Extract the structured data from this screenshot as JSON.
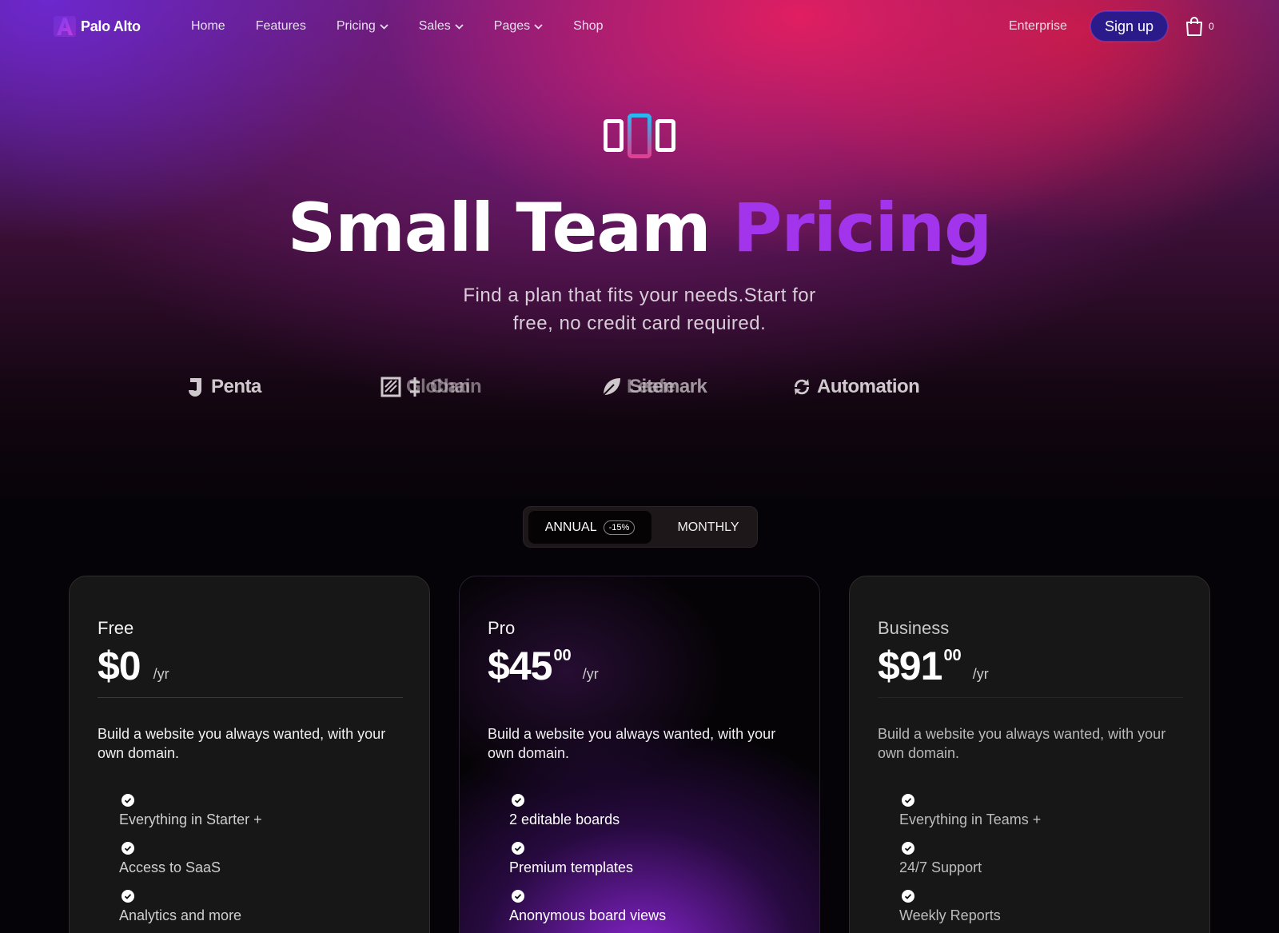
{
  "nav": {
    "brand": "Palo Alto",
    "links": [
      {
        "label": "Home",
        "dropdown": false
      },
      {
        "label": "Features",
        "dropdown": false
      },
      {
        "label": "Pricing",
        "dropdown": true
      },
      {
        "label": "Sales",
        "dropdown": true
      },
      {
        "label": "Pages",
        "dropdown": true
      },
      {
        "label": "Shop",
        "dropdown": false
      }
    ],
    "enterprise": "Enterprise",
    "signup": "Sign up",
    "cart_count": "0",
    "icons": [
      "logo-icon",
      "chevron-down-icon",
      "shopping-bag-icon"
    ]
  },
  "hero": {
    "title_main": "Small Team",
    "title_accent": "Pricing",
    "subtitle": "Find a plan that fits your needs.Start for free, no credit card required.",
    "accent_color": "#a234ec"
  },
  "brands": [
    {
      "name": "Penta",
      "icon": "penta-logo-icon"
    },
    {
      "name": "Globan",
      "icon": "globan-logo-icon"
    },
    {
      "name": "Chain",
      "icon": "chain-logo-icon"
    },
    {
      "name": "Leafe",
      "icon": "leafe-logo-icon"
    },
    {
      "name": "Sitemark",
      "icon": "sitemark-logo-icon"
    },
    {
      "name": "Automation",
      "icon": "automation-logo-icon"
    }
  ],
  "billing": {
    "annual": "ANNUAL",
    "annual_badge": "-15%",
    "monthly": "MONTHLY",
    "selected": "annual"
  },
  "plans": [
    {
      "name": "Free",
      "price": "$0",
      "cents": "",
      "unit": "/yr",
      "description": "Build a website you always wanted, with your own domain.",
      "features": [
        "Everything in Starter +",
        "Access to SaaS",
        "Analytics and more"
      ]
    },
    {
      "name": "Pro",
      "price": "$45",
      "cents": "00",
      "unit": "/yr",
      "description": "Build a website you always wanted, with your own domain.",
      "features": [
        "2 editable boards",
        "Premium templates",
        "Anonymous board views"
      ]
    },
    {
      "name": "Business",
      "price": "$91",
      "cents": "00",
      "unit": "/yr",
      "description": "Build a website you always wanted, with your own domain.",
      "features": [
        "Everything in Teams +",
        "24/7 Support",
        "Weekly Reports"
      ]
    }
  ]
}
